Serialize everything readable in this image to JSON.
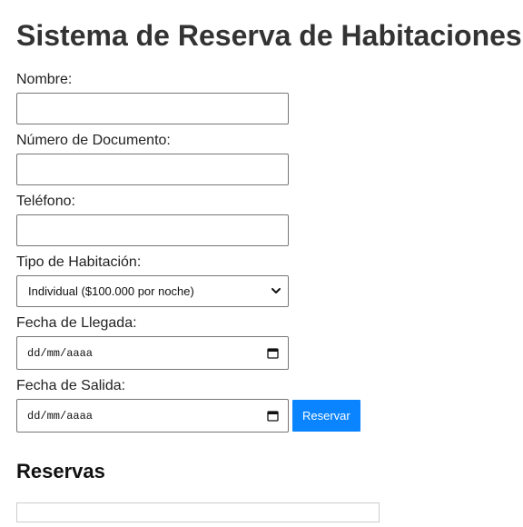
{
  "page": {
    "title": "Sistema de Reserva de Habitaciones"
  },
  "form": {
    "nombre_label": "Nombre:",
    "nombre_value": "",
    "documento_label": "Número de Documento:",
    "documento_value": "",
    "telefono_label": "Teléfono:",
    "telefono_value": "",
    "tipo_label": "Tipo de Habitación:",
    "tipo_selected": "Individual ($100.000 por noche)",
    "llegada_label": "Fecha de Llegada:",
    "llegada_placeholder": "dd/mm/aaaa",
    "salida_label": "Fecha de Salida:",
    "salida_placeholder": "dd/mm/aaaa",
    "submit_label": "Reservar"
  },
  "reservations": {
    "heading": "Reservas",
    "items": []
  },
  "colors": {
    "accent": "#0a84ff",
    "text": "#333333",
    "border": "#767676"
  },
  "icons": {
    "select": "chevron-down-icon",
    "date": "calendar-icon"
  }
}
